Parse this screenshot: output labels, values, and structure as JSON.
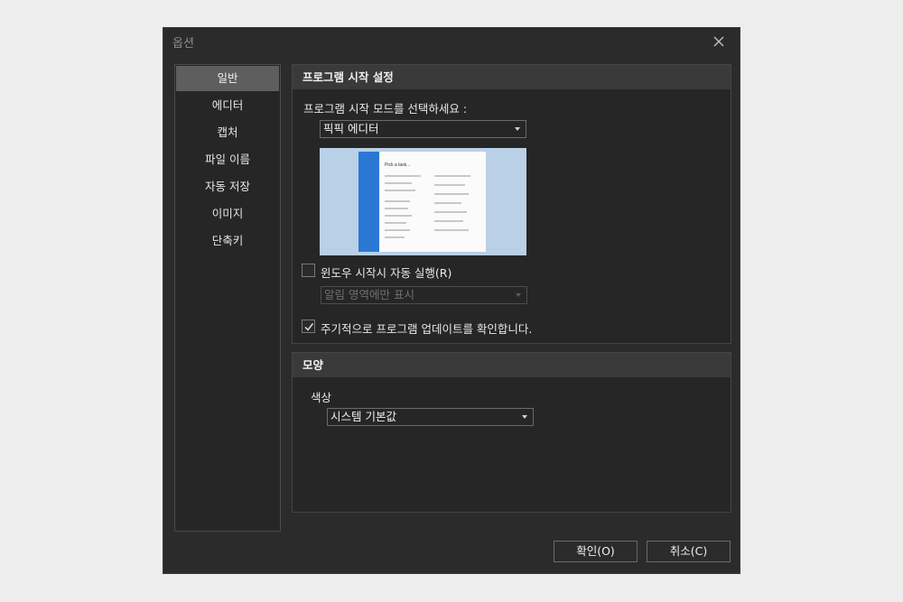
{
  "dialog": {
    "title": "옵션",
    "close_icon": "close-icon",
    "sidebar": {
      "items": [
        {
          "label": "일반",
          "active": true
        },
        {
          "label": "에디터",
          "active": false
        },
        {
          "label": "캡처",
          "active": false
        },
        {
          "label": "파일 이름",
          "active": false
        },
        {
          "label": "자동 저장",
          "active": false
        },
        {
          "label": "이미지",
          "active": false
        },
        {
          "label": "단축키",
          "active": false
        }
      ]
    },
    "startup": {
      "title": "프로그램 시작 설정",
      "mode_label": "프로그램 시작 모드를 선택하세요 :",
      "mode_value": "픽픽 에디터",
      "preview_heading": "Pick a task...",
      "autostart_label": "윈도우 시작시 자동 실행(R)",
      "autostart_checked": false,
      "tray_value": "알림 영역에만 표시",
      "tray_disabled": true,
      "update_label": "주기적으로 프로그램 업데이트를 확인합니다.",
      "update_checked": true
    },
    "appearance": {
      "title": "모양",
      "color_label": "색상",
      "color_value": "시스템 기본값"
    },
    "buttons": {
      "ok": "확인(O)",
      "cancel": "취소(C)"
    },
    "colors": {
      "background": "#2b2b2b",
      "section_header": "#3a3a3a",
      "active_item": "#5e5e5e",
      "preview_accent": "#2a78d4",
      "preview_bg": "#b9d0e6"
    }
  }
}
